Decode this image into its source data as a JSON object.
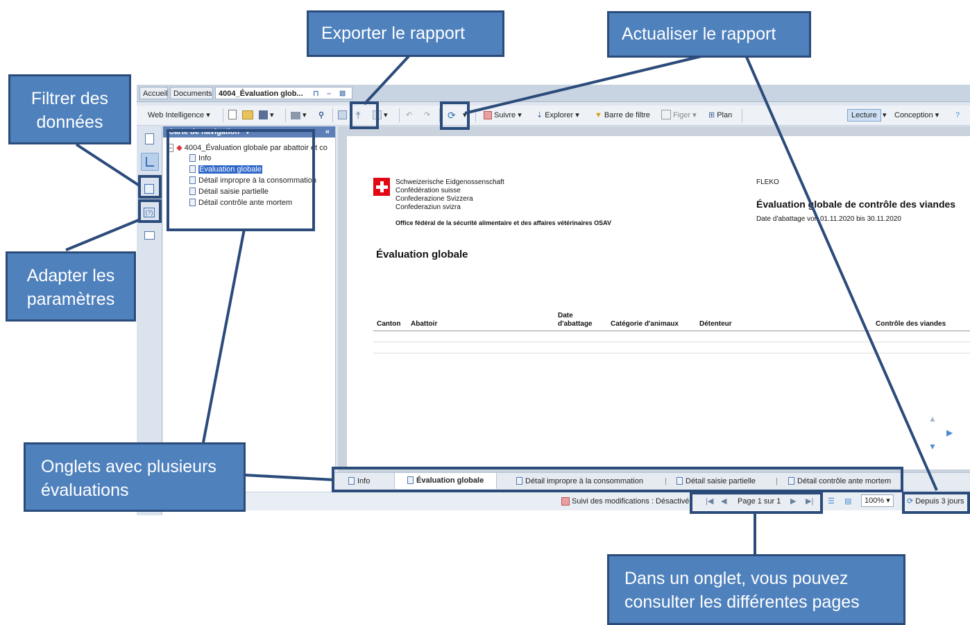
{
  "app": {
    "doc_tabs": [
      {
        "label": "Accueil"
      },
      {
        "label": "Documents"
      },
      {
        "label": "4004_Évaluation glob..."
      }
    ],
    "toolbar": {
      "web_intelligence": "Web Intelligence",
      "suivre": "Suivre",
      "explorer": "Explorer",
      "barre_filtre": "Barre de filtre",
      "figer": "Figer",
      "plan": "Plan",
      "lecture": "Lecture",
      "conception": "Conception"
    },
    "nav": {
      "header": "Carte de navigation",
      "root": "4004_Évaluation globale par abattoir et co",
      "items": [
        {
          "label": "Info"
        },
        {
          "label": "Évaluation globale"
        },
        {
          "label": "Détail impropre à la consommation"
        },
        {
          "label": "Détail saisie partielle"
        },
        {
          "label": "Détail contrôle ante mortem"
        }
      ]
    },
    "report": {
      "org_line1": "Schweizerische Eidgenossenschaft",
      "org_line2": "Confédération suisse",
      "org_line3": "Confederazione Svizzera",
      "org_line4": "Confederaziun svizra",
      "office": "Office fédéral de la sécurité alimentaire et des affaires vétérinaires OSAV",
      "system": "FLEKO",
      "report_title": "Évaluation globale de contrôle des viandes",
      "date_range": "Date d'abattage von 01.11.2020 bis 30.11.2020",
      "section_title": "Évaluation globale",
      "columns": [
        {
          "label": "Canton"
        },
        {
          "label": "Abattoir"
        },
        {
          "label": "Date d'abattage"
        },
        {
          "label": "Catégorie d'animaux"
        },
        {
          "label": "Détenteur"
        },
        {
          "label": "Contrôle des viandes"
        }
      ]
    },
    "bottom_tabs": [
      {
        "label": "Info"
      },
      {
        "label": "Évaluation globale"
      },
      {
        "label": "Détail impropre à la consommation"
      },
      {
        "label": "Détail saisie partielle"
      },
      {
        "label": "Détail contrôle ante mortem"
      }
    ],
    "status": {
      "tracking": "Suivi des modifications : Désactivé",
      "page": "Page 1 sur 1",
      "zoom": "100%",
      "refresh": "Depuis 3 jours"
    }
  },
  "annotations": {
    "export": "Exporter le rapport",
    "refresh": "Actualiser le rapport",
    "filter_line1": "Filtrer des",
    "filter_line2": "données",
    "params_line1": "Adapter les",
    "params_line2": "paramètres",
    "tabs_line1": "Onglets avec plusieurs",
    "tabs_line2": "évaluations",
    "pages_line1": "Dans un onglet, vous pouvez",
    "pages_line2": "consulter les différentes pages"
  },
  "colors": {
    "callout_fill": "#4f81bd",
    "callout_border": "#2b4b7a",
    "swiss_red": "#e30613"
  }
}
